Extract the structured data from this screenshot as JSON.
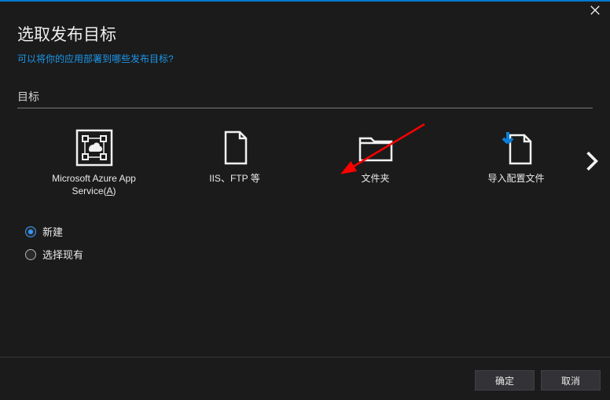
{
  "window": {
    "title": "选取发布目标",
    "subtitle_link": "可以将你的应用部署到哪些发布目标?",
    "section_label": "目标"
  },
  "targets": [
    {
      "id": "azure-app-service",
      "label_line1": "Microsoft Azure App",
      "label_line2_prefix": "Service(",
      "label_line2_u": "A",
      "label_line2_suffix": ")"
    },
    {
      "id": "iis-ftp",
      "label": "IIS、FTP 等"
    },
    {
      "id": "folder",
      "label": "文件夹"
    },
    {
      "id": "import-profile",
      "label": "导入配置文件"
    }
  ],
  "radio": {
    "create_new": "新建",
    "select_existing": "选择现有",
    "selected": "create_new"
  },
  "footer": {
    "ok": "确定",
    "cancel": "取消"
  }
}
